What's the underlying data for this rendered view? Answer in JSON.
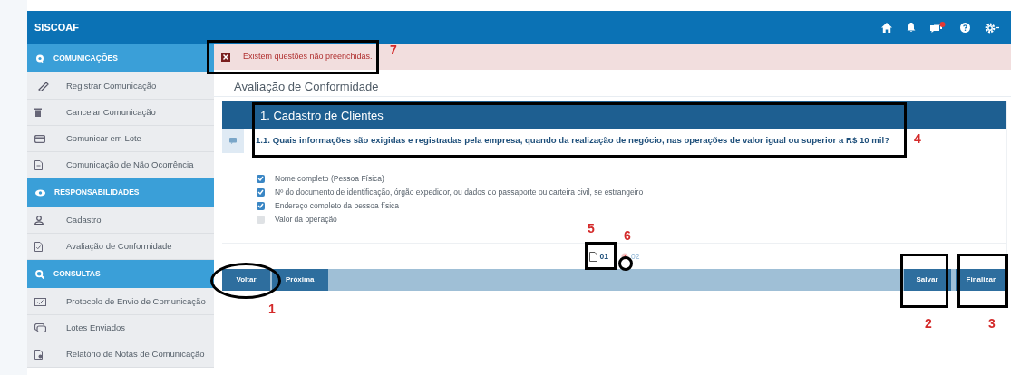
{
  "app": {
    "title": "SISCOAF"
  },
  "sidebar": {
    "sections": [
      {
        "title": "COMUNICAÇÕES",
        "items": [
          {
            "label": "Registrar Comunicação"
          },
          {
            "label": "Cancelar Comunicação"
          },
          {
            "label": "Comunicar em Lote"
          },
          {
            "label": "Comunicação de Não Ocorrência"
          }
        ]
      },
      {
        "title": "RESPONSABILIDADES",
        "items": [
          {
            "label": "Cadastro"
          },
          {
            "label": "Avaliação de Conformidade"
          }
        ]
      },
      {
        "title": "CONSULTAS",
        "items": [
          {
            "label": "Protocolo de Envio de Comunicação"
          },
          {
            "label": "Lotes Enviados"
          },
          {
            "label": "Relatório de Notas de Comunicação"
          }
        ]
      }
    ]
  },
  "alert": {
    "message": "Existem questões não preenchidas."
  },
  "page_title": "Avaliação de Conformidade",
  "section": {
    "title": "1. Cadastro de Clientes",
    "question": "1.1. Quais informações são exigidas e registradas pela empresa, quando da realização de negócio, nas operações de valor igual ou superior a R$ 10 mil?",
    "options": [
      {
        "label": "Nome completo (Pessoa Física)",
        "checked": true
      },
      {
        "label": "Nº do documento de identificação, órgão expedidor, ou dados do passaporte ou carteira civil, se estrangeiro",
        "checked": true
      },
      {
        "label": "Endereço completo da pessoa física",
        "checked": true
      },
      {
        "label": "Valor da operação",
        "checked": false
      }
    ]
  },
  "pagination": {
    "pages": [
      {
        "label": "01",
        "selected": true
      },
      {
        "label": "02",
        "selected": false
      }
    ]
  },
  "nav_buttons": [
    "Voltar",
    "Próxima"
  ],
  "action_buttons": [
    "Salvar",
    "Finalizar"
  ],
  "annotations": [
    {
      "label": "7",
      "kind": "box"
    },
    {
      "label": "4",
      "kind": "box"
    },
    {
      "label": "5",
      "kind": "box"
    },
    {
      "label": "6",
      "kind": "ellipse"
    },
    {
      "label": "1",
      "kind": "ellipse"
    },
    {
      "label": "2",
      "kind": "box"
    },
    {
      "label": "3",
      "kind": "box"
    }
  ]
}
